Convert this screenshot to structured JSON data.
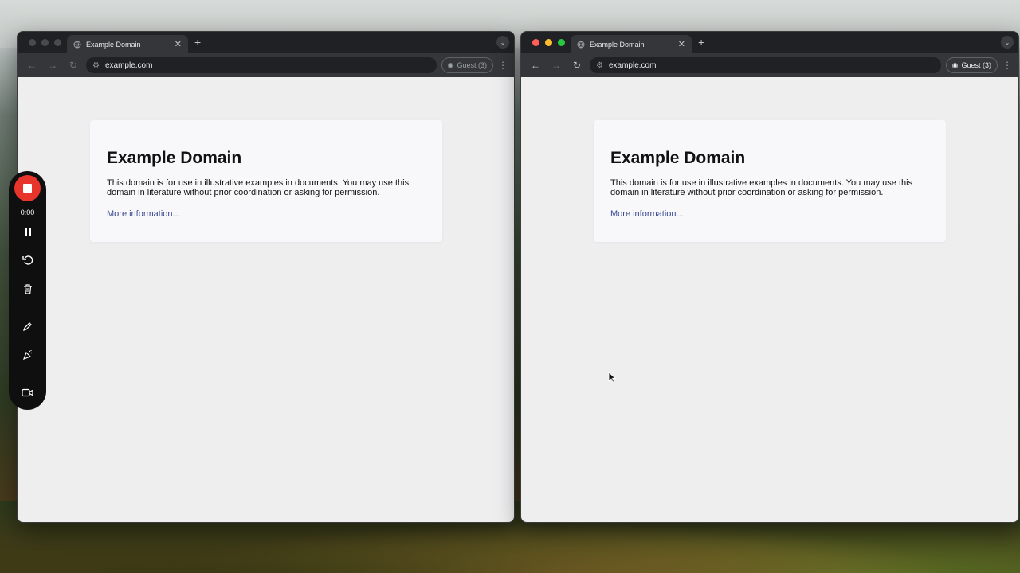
{
  "windows": [
    {
      "id": "left",
      "tab_title": "Example Domain",
      "url": "example.com",
      "profile_label": "Guest (3)",
      "page": {
        "heading": "Example Domain",
        "body": "This domain is for use in illustrative examples in documents. You may use this domain in literature without prior coordination or asking for permission.",
        "link": "More information..."
      }
    },
    {
      "id": "right",
      "tab_title": "Example Domain",
      "url": "example.com",
      "profile_label": "Guest (3)",
      "page": {
        "heading": "Example Domain",
        "body": "This domain is for use in illustrative examples in documents. You may use this domain in literature without prior coordination or asking for permission.",
        "link": "More information..."
      }
    }
  ],
  "recorder": {
    "elapsed": "0:00",
    "controls": [
      "stop-icon",
      "pause-icon",
      "restart-icon",
      "trash-icon",
      "pen-icon",
      "effects-icon",
      "camera-icon"
    ]
  },
  "colors": {
    "record_red": "#e8352c",
    "link_blue": "#38488f",
    "traffic_red": "#ff5f57",
    "traffic_yellow": "#febc2e",
    "traffic_green": "#28c840"
  }
}
